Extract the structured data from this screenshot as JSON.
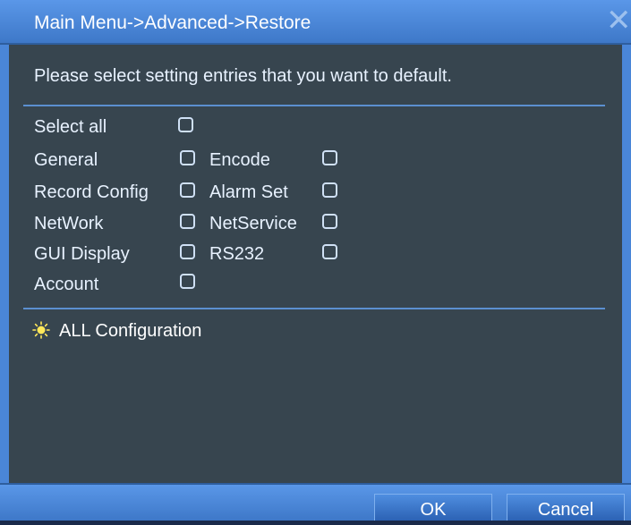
{
  "window": {
    "title": "Main Menu->Advanced->Restore",
    "close_icon": "close-icon"
  },
  "instruction": "Please select setting entries that you want to default.",
  "options": {
    "select_all": "Select all",
    "general": "General",
    "encode": "Encode",
    "record_config": "Record Config",
    "alarm_set": "Alarm Set",
    "network": "NetWork",
    "netservice": "NetService",
    "gui_display": "GUI Display",
    "rs232": "RS232",
    "account": "Account"
  },
  "summary": {
    "icon": "bulb-icon",
    "label": "ALL Configuration"
  },
  "buttons": {
    "ok": "OK",
    "cancel": "Cancel"
  },
  "colors": {
    "accent": "#4a86d8",
    "background": "#37454f",
    "text": "#e8f2ff"
  }
}
